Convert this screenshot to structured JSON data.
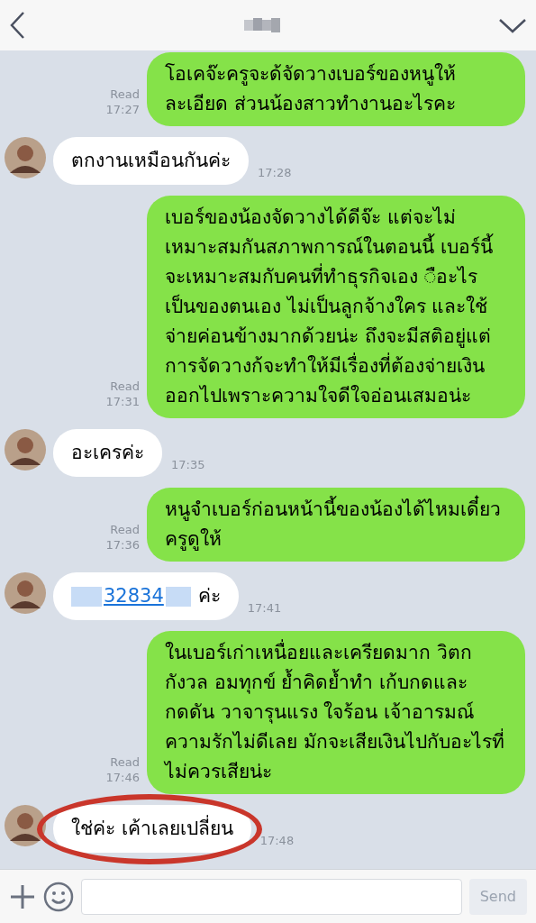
{
  "messages": [
    {
      "kind": "outgoing",
      "text": "โอเคจ๊ะครูจะด้จัดวางเบอร์ของหนูให้ละเอียด ส่วนน้องสาวทำงานอะไรคะ",
      "read": "Read",
      "time": "17:27",
      "circled": false
    },
    {
      "kind": "incoming",
      "text": "ตกงานเหมือนกันค่ะ",
      "time": "17:28",
      "circled": false
    },
    {
      "kind": "outgoing",
      "text": "เบอร์ของน้องจัดวางได้ดีจ๊ะ แต่จะไม่เหมาะสมกันสภาพการณ์ในตอนนี้ เบอร์นี้จะเหมาะสมกับคนที่ทำธุรกิจเอง ◌ือะไรเป็นของตนเอง ไม่เป็นลูกจ้างใคร และใช้จ่ายค่อนข้างมากด้วยน่ะ ถึงจะมีสติอยู่แต่การจัดวางก้จะทำให้มีเรื่องที่ต้องจ่ายเงินออกไปเพราะความใจดีใจอ่อนเสมอน่ะ",
      "read": "Read",
      "time": "17:31",
      "circled": false
    },
    {
      "kind": "incoming",
      "text": "อะเครค่ะ",
      "time": "17:35",
      "circled": false
    },
    {
      "kind": "outgoing",
      "text": "หนูจำเบอร์ก่อนหน้านี้ของน้องได้ไหมเดี๋ยวครูดูให้",
      "read": "Read",
      "time": "17:36",
      "circled": false
    },
    {
      "kind": "number",
      "link": "32834",
      "suffix": "ค่ะ",
      "time": "17:41",
      "circled": false
    },
    {
      "kind": "outgoing",
      "text": "ในเบอร์เก่าเหนื่อยและเครียดมาก วิตกกังวล อมทุกข์ ย้ำคิดย้ำทำ เก้บกดและกดดัน วาจารุนแรง ใจร้อน เจ้าอารมณ์ความรักไม่ดีเลย มักจะเสียเงินไปกับอะไรที่ไม่ควรเสียน่ะ",
      "read": "Read",
      "time": "17:46",
      "circled": false
    },
    {
      "kind": "incoming",
      "text": "ใช่ค่ะ เค้าเลยเปลี่ยน",
      "time": "17:48",
      "circled": true
    }
  ],
  "composer": {
    "send": "Send"
  }
}
